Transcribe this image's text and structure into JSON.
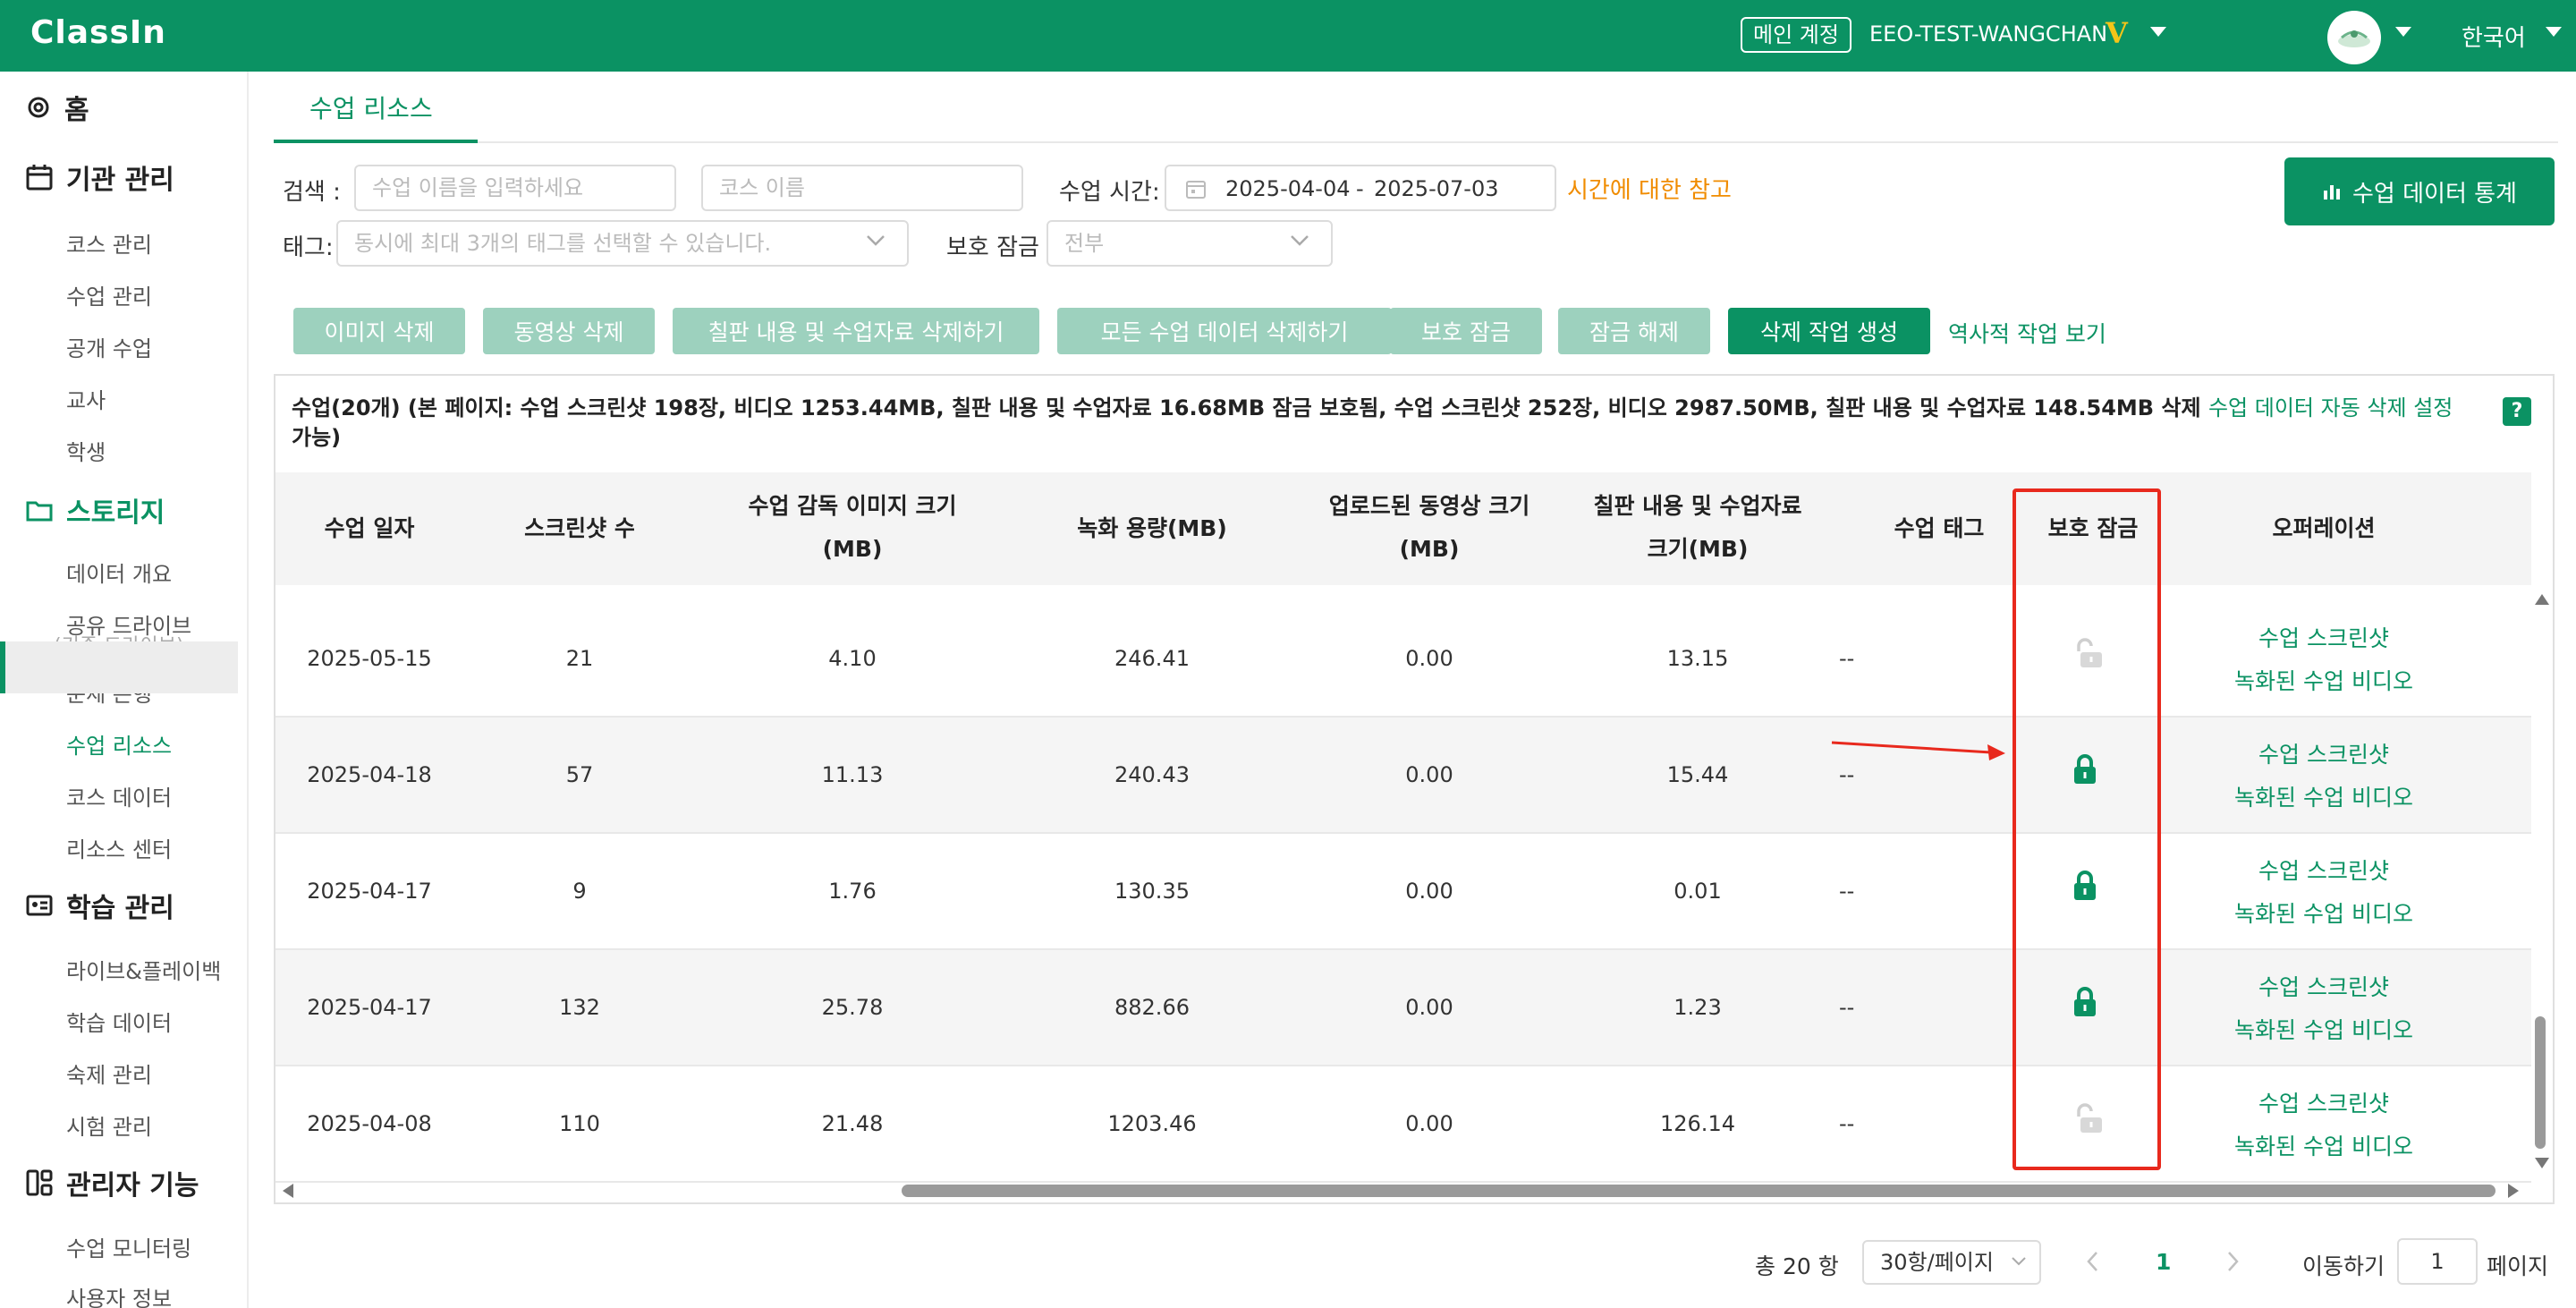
{
  "topbar": {
    "logo": "ClassIn",
    "account_badge": "메인 계정",
    "account_name": "EEO-TEST-WANGCHAN",
    "vip_mark": "V",
    "language": "한국어"
  },
  "sidebar": {
    "home": "홈",
    "sections": [
      {
        "label": "기관 관리",
        "items": [
          "코스 관리",
          "수업 관리",
          "공개 수업",
          "교사",
          "학생"
        ]
      },
      {
        "label": "스토리지",
        "items": [
          "데이터 개요",
          "공유 드라이브",
          "(기존 드라이브)",
          "문제 은행",
          "수업 리소스",
          "코스 데이터",
          "리소스 센터"
        ]
      },
      {
        "label": "학습 관리",
        "items": [
          "라이브&플레이백",
          "학습 데이터",
          "숙제 관리",
          "시험 관리"
        ]
      },
      {
        "label": "관리자 기능",
        "items": [
          "수업 모니터링",
          "사용자 정보"
        ]
      }
    ]
  },
  "tab": "수업 리소스",
  "filters": {
    "search_label": "검색 :",
    "lesson_placeholder": "수업 이름을 입력하세요",
    "course_placeholder": "코스 이름",
    "time_label": "수업 시간:",
    "date_start": "2025-04-04",
    "date_sep": "-",
    "date_end": "2025-07-03",
    "time_note": "시간에 대한 참고",
    "tag_label": "태그:",
    "tag_placeholder": "동시에 최대 3개의 태그를 선택할 수 있습니다.",
    "lock_label": "보호 잠금",
    "lock_value": "전부",
    "stats_button": "수업 데이터 통계"
  },
  "actions": [
    "이미지 삭제",
    "동영상 삭제",
    "칠판 내용 및 수업자료 삭제하기",
    "모든 수업 데이터 삭제하기",
    "보호 잠금",
    "잠금 해제",
    "삭제 작업 생성"
  ],
  "history_link": "역사적 작업 보기",
  "summary": {
    "text_line1": "수업(20개)   (본 페이지: 수업 스크린샷 198장, 비디오 1253.44MB, 칠판 내용 및 수업자료 16.68MB 잠금 보호됨, 수업 스크린샷 252장, 비디오 2987.50MB, 칠판 내용 및 수업자료 148.54MB 삭제",
    "text_line2": "가능)",
    "auto_delete_link": "수업 데이터 자동 삭제 설정",
    "help": "?"
  },
  "table": {
    "headers": {
      "date": "수업 일자",
      "screens": "스크린샷 수",
      "img_size_1": "수업 감독 이미지 크기",
      "img_size_2": "(MB)",
      "rec": "녹화 용량(MB)",
      "upload_1": "업로드된 동영상 크기",
      "upload_2": "(MB)",
      "board_1": "칠판 내용 및 수업자료",
      "board_2": "크기(MB)",
      "tag": "수업 태그",
      "lock": "보호 잠금",
      "ops": "오퍼레이션"
    },
    "rows": [
      {
        "date": "2025-05-15",
        "screens": "21",
        "img": "4.10",
        "rec": "246.41",
        "upload": "0.00",
        "board": "13.15",
        "tag": "--",
        "locked": false,
        "op1": "수업 스크린샷",
        "op2": "녹화된 수업 비디오"
      },
      {
        "date": "2025-04-18",
        "screens": "57",
        "img": "11.13",
        "rec": "240.43",
        "upload": "0.00",
        "board": "15.44",
        "tag": "--",
        "locked": true,
        "op1": "수업 스크린샷",
        "op2": "녹화된 수업 비디오"
      },
      {
        "date": "2025-04-17",
        "screens": "9",
        "img": "1.76",
        "rec": "130.35",
        "upload": "0.00",
        "board": "0.01",
        "tag": "--",
        "locked": true,
        "op1": "수업 스크린샷",
        "op2": "녹화된 수업 비디오"
      },
      {
        "date": "2025-04-17",
        "screens": "132",
        "img": "25.78",
        "rec": "882.66",
        "upload": "0.00",
        "board": "1.23",
        "tag": "--",
        "locked": true,
        "op1": "수업 스크린샷",
        "op2": "녹화된 수업 비디오"
      },
      {
        "date": "2025-04-08",
        "screens": "110",
        "img": "21.48",
        "rec": "1203.46",
        "upload": "0.00",
        "board": "126.14",
        "tag": "--",
        "locked": false,
        "op1": "수업 스크린샷",
        "op2": "녹화된 수업 비디오"
      }
    ]
  },
  "pagination": {
    "total": "총 20 항",
    "per_page": "30항/페이지",
    "current": "1",
    "goto_label": "이동하기",
    "goto_value": "1",
    "page_suffix": "페이지"
  },
  "colors": {
    "brand": "#0b9263",
    "highlight": "#e8291d",
    "link_orange": "#f08c00"
  }
}
